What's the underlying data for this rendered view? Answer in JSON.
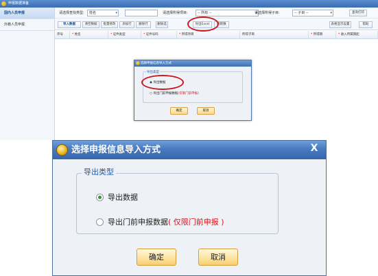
{
  "app": {
    "title": "申报数据准备"
  },
  "sidebar": {
    "items": [
      {
        "label": "国内人员申报",
        "active": true
      },
      {
        "label": "外籍人员申报",
        "active": false
      }
    ]
  },
  "filters": {
    "search_type_label": "请选择查找类型:",
    "search_type_value": "姓名",
    "item_label": "请选择所得项目:",
    "item_value": "-- 所有 --",
    "subitem_label": "请选择所得子目:",
    "subitem_value": "-- 子目 --",
    "query_button": "查询打印"
  },
  "toolbar": {
    "buttons": [
      "导入数据",
      "清空数据",
      "批量修改",
      "添加行",
      "删除行",
      "删除选",
      "导出Excel",
      "刷新数"
    ],
    "right_buttons": [
      "表格显示设置",
      "帮助"
    ]
  },
  "table": {
    "columns": [
      {
        "label": "序号",
        "required": false
      },
      {
        "label": "姓名",
        "required": true
      },
      {
        "label": "证件类型",
        "required": true
      },
      {
        "label": "证件号码",
        "required": true
      },
      {
        "label": "所得项目",
        "required": true
      },
      {
        "label": "所得子目",
        "required": false
      },
      {
        "label": "所得期",
        "required": true
      },
      {
        "label": "收入所属期起",
        "required": true
      }
    ]
  },
  "mini_dialog": {
    "title": "选择申报信息导入方式",
    "group_label": "导出类型",
    "option1": "导出数据",
    "option2": "导出门前申报数据",
    "option2_note": "(仅限门前申报)",
    "ok": "确定",
    "cancel": "取消"
  },
  "dialog": {
    "title": "选择申报信息导入方式",
    "close": "X",
    "group_label": "导出类型",
    "option1": "导出数据",
    "option2": "导出门前申报数据",
    "option2_note": "( 仅限门前申报 )",
    "ok_button": "确定",
    "cancel_button": "取消"
  },
  "colors": {
    "title_bar": "#3a6cb3",
    "highlight": "#c8191f",
    "note": "#d8141b",
    "radio_dot": "#2b9a2b",
    "button_bg": "#fde4a2"
  },
  "icons": {
    "app_logo": "app-logo-icon",
    "close": "close-icon",
    "dropdown": "chevron-down-icon"
  }
}
